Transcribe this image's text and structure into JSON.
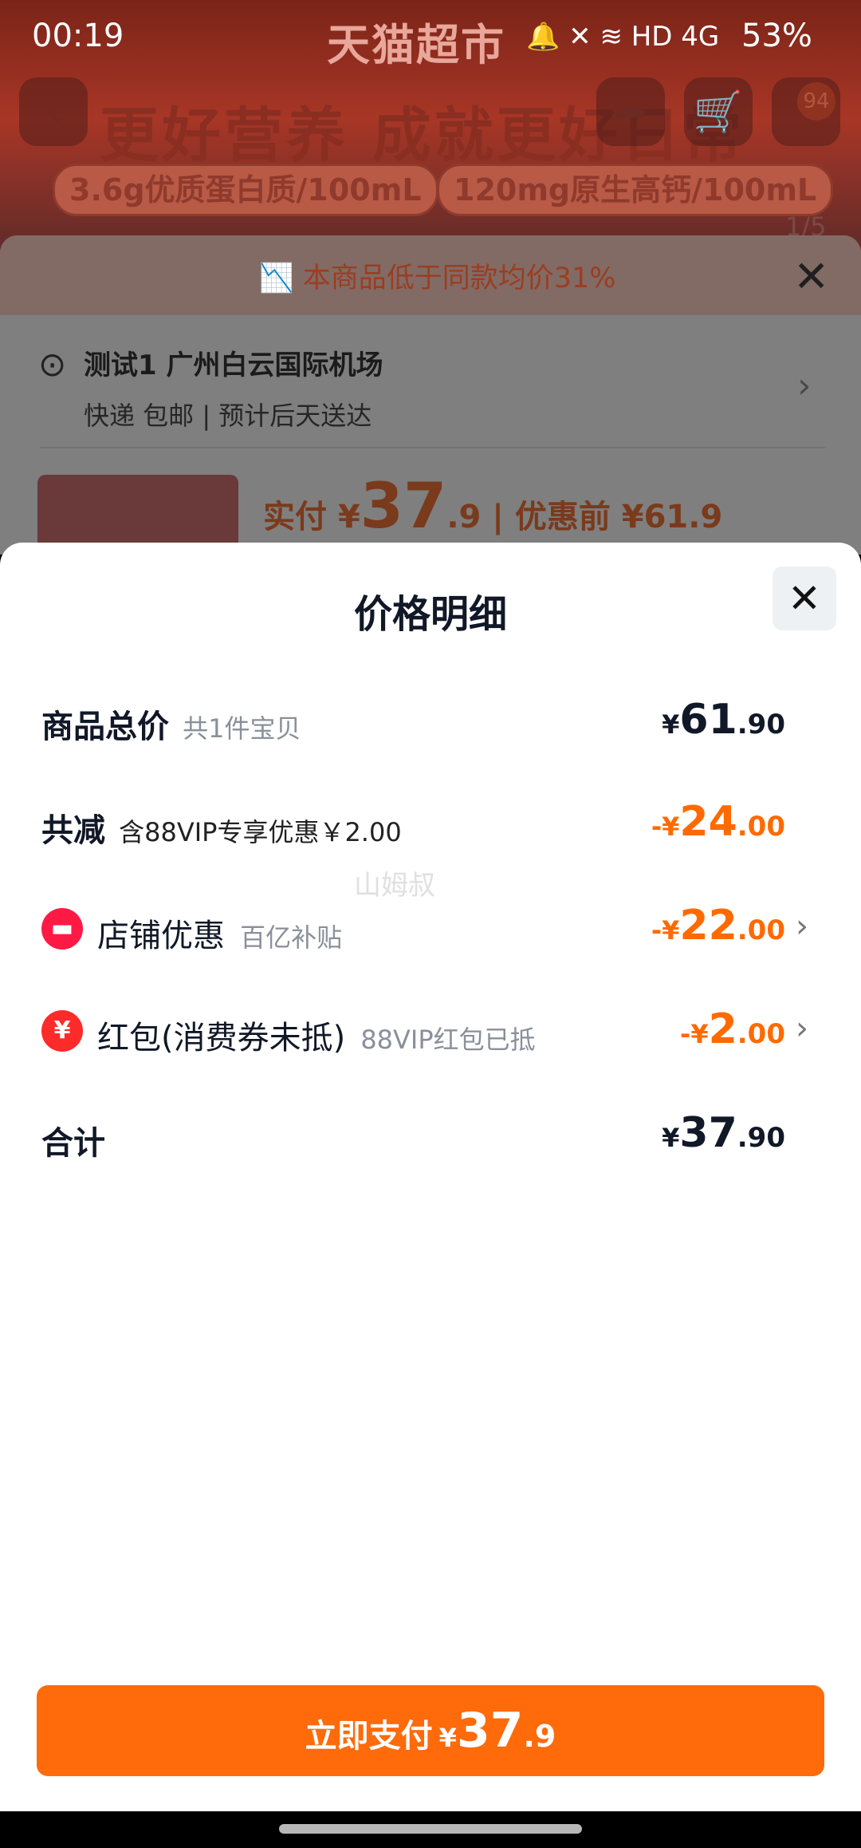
{
  "status_bar": {
    "time": "00:19",
    "battery": "53%",
    "icons_text": "🔔 ✕ ≋ HD 4G"
  },
  "background": {
    "brand": "天猫超市",
    "slogan": "更好营养 成就更好日常",
    "chip_protein": "3.6g优质蛋白质/100mL",
    "chip_calcium": "120mg原生高钙/100mL",
    "cart_badge": "94",
    "pager": "1/5",
    "banner": "本商品低于同款均价31%",
    "address": "测试1 广州白云国际机场",
    "delivery": "快递 包邮 | 预计后天送达",
    "price_label": "实付",
    "price_cur": "¥",
    "price_int": "37",
    "price_dec": ".9",
    "price_before": "| 优惠前 ¥61.9"
  },
  "sheet": {
    "title": "价格明细",
    "rows": [
      {
        "label": "商品总价",
        "sub": "共1件宝贝",
        "amount_cur": "¥",
        "amount_int": "61",
        "amount_dec": ".90"
      },
      {
        "label": "共减",
        "sub": "含88VIP专享优惠￥2.00",
        "amount_cur": "-¥",
        "amount_int": "24",
        "amount_dec": ".00"
      },
      {
        "label": "店铺优惠",
        "sub": "百亿补贴",
        "amount_cur": "-¥",
        "amount_int": "22",
        "amount_dec": ".00",
        "icon": "shop-icon"
      },
      {
        "label": "红包(消费券未抵)",
        "sub": "88VIP红包已抵",
        "amount_cur": "-¥",
        "amount_int": "2",
        "amount_dec": ".00",
        "icon": "red-packet-icon"
      },
      {
        "label": "合计",
        "sub": "",
        "amount_cur": "¥",
        "amount_int": "37",
        "amount_dec": ".90"
      }
    ],
    "watermark": "山姆叔"
  },
  "pay_button": {
    "label": "立即支付",
    "cur": "¥",
    "int": "37",
    "dec": ".9"
  },
  "colors": {
    "accent": "#ff6a00",
    "discount_icon": "#ff1a46"
  }
}
